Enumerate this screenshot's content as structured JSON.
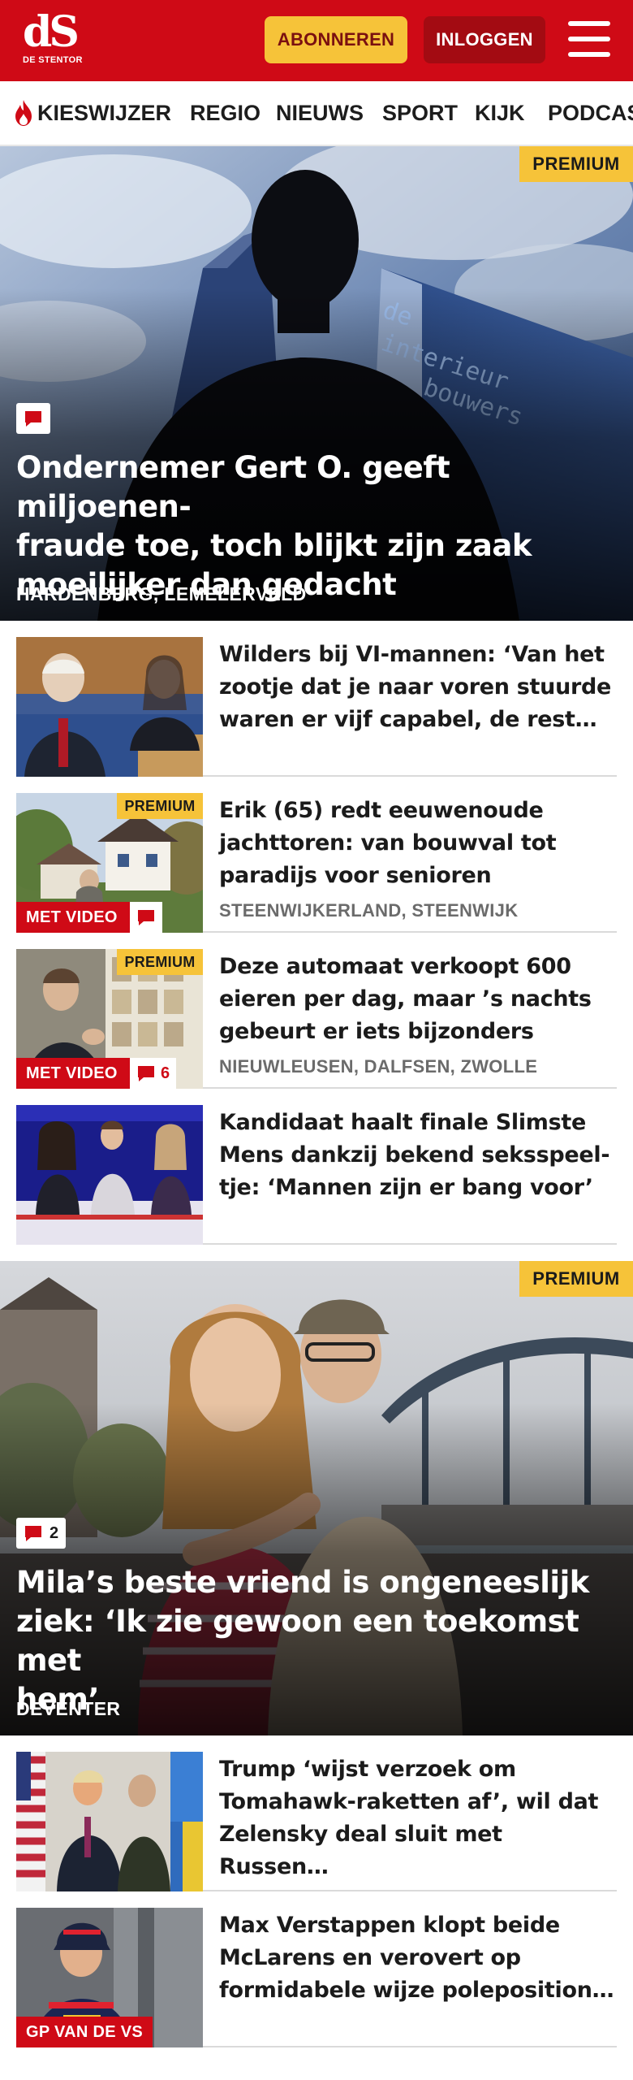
{
  "header": {
    "logo_mark": "dS",
    "logo_sub": "DE STENTOR",
    "subscribe_label": "ABONNEREN",
    "login_label": "INLOGGEN"
  },
  "nav": {
    "items": [
      "KIESWIJZER",
      "REGIO",
      "NIEUWS",
      "SPORT",
      "KIJK",
      "PODCAST"
    ]
  },
  "hero1": {
    "badge": "PREMIUM",
    "title_lines": [
      "Ondernemer Gert O. geeft miljoenen-",
      "fraude toe, toch blijkt zijn zaak",
      "moeilijker dan gedacht"
    ],
    "location": "HARDENBERG, LEMELERVELD",
    "sign_text": "de interieur bouwers"
  },
  "articles1": [
    {
      "title_lines": [
        "Wilders bij VI-mannen: ‘Van het",
        "zootje dat je naar voren stuurde",
        "waren er vijf capabel, de rest…"
      ],
      "location": ""
    },
    {
      "badge": "PREMIUM",
      "tag": "MET VIDEO",
      "title_lines": [
        "Erik (65) redt eeuwenoude",
        "jachttoren: van bouwval tot",
        "paradijs voor senioren"
      ],
      "location": "STEENWIJKERLAND, STEENWIJK"
    },
    {
      "badge": "PREMIUM",
      "tag": "MET VIDEO",
      "comments": "6",
      "title_lines": [
        "Deze automaat verkoopt 600",
        "eieren per dag, maar ’s nachts",
        "gebeurt er iets bijzonders"
      ],
      "location": "NIEUWLEUSEN, DALFSEN, ZWOLLE"
    },
    {
      "title_lines": [
        "Kandidaat haalt finale Slimste",
        "Mens dankzij bekend seksspeel-",
        "tje: ‘Mannen zijn er bang voor’"
      ],
      "location": ""
    }
  ],
  "hero2": {
    "badge": "PREMIUM",
    "comments": "2",
    "title_lines": [
      "Mila’s beste vriend is ongeneeslijk",
      "ziek: ‘Ik zie gewoon een toekomst met",
      "hem’"
    ],
    "location": "DEVENTER"
  },
  "articles2": [
    {
      "title_lines": [
        "Trump ‘wijst verzoek om",
        "Tomahawk-raketten af’, wil dat",
        "Zelensky deal sluit met Russen…"
      ],
      "location": ""
    },
    {
      "tag": "GP VAN DE VS",
      "title_lines": [
        "Max Verstappen klopt beide",
        "McLarens en verovert op",
        "formidabele wijze poleposition…"
      ],
      "location": ""
    }
  ],
  "colors": {
    "brand_red": "#cf0a16",
    "premium_yellow": "#f6c339",
    "login_dark_red": "#a30b12"
  },
  "icons": [
    "flame-icon",
    "menu-icon",
    "comment-icon"
  ]
}
